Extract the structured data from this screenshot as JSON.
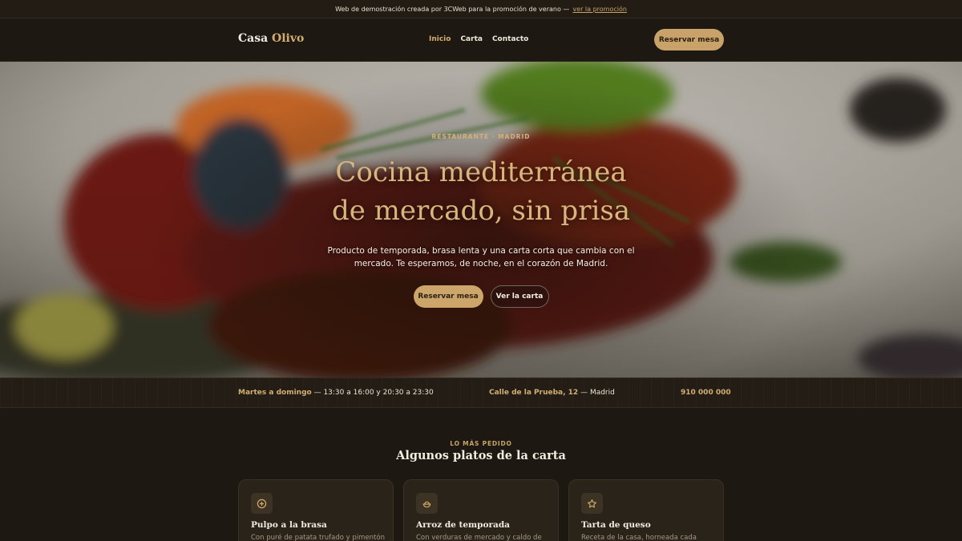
{
  "promo": {
    "text": "Web de demostración creada por 3CWeb para la promoción de verano —",
    "link": "ver la promoción"
  },
  "nav": {
    "brand_main": "Casa",
    "brand_accent": "Olivo",
    "links": [
      "Inicio",
      "Carta",
      "Contacto"
    ],
    "active_link": "Inicio",
    "cta": "Reservar mesa"
  },
  "hero": {
    "eyebrow": "RESTAURANTE · MADRID",
    "title_line1": "Cocina mediterránea",
    "title_line2": "de mercado, sin prisa",
    "subtitle": "Producto de temporada, brasa lenta y una carta corta que cambia con el mercado. Te esperamos, de noche, en el corazón de Madrid.",
    "primary_button": "Reservar mesa",
    "secondary_button": "Ver la carta"
  },
  "info": {
    "days": "Martes a domingo",
    "hours": "— 13:30 a 16:00 y 20:30 a 23:30",
    "street": "Calle de la Prueba, 12",
    "city": "— Madrid",
    "phone": "910 000 000"
  },
  "section": {
    "eyebrow": "LO MÁS PEDIDO",
    "title": "Algunos platos de la carta"
  },
  "dishes": [
    {
      "icon": "plus-circle-icon",
      "title": "Pulpo a la brasa",
      "desc": "Con puré de patata trufado y pimentón"
    },
    {
      "icon": "bowl-icon",
      "title": "Arroz de temporada",
      "desc": "Con verduras de mercado y caldo de"
    },
    {
      "icon": "star-icon",
      "title": "Tarta de queso",
      "desc": "Receta de la casa, horneada cada"
    }
  ],
  "colors": {
    "background": "#1d1812",
    "accent": "#c9a26a",
    "accent_text": "#d4ad6e"
  }
}
